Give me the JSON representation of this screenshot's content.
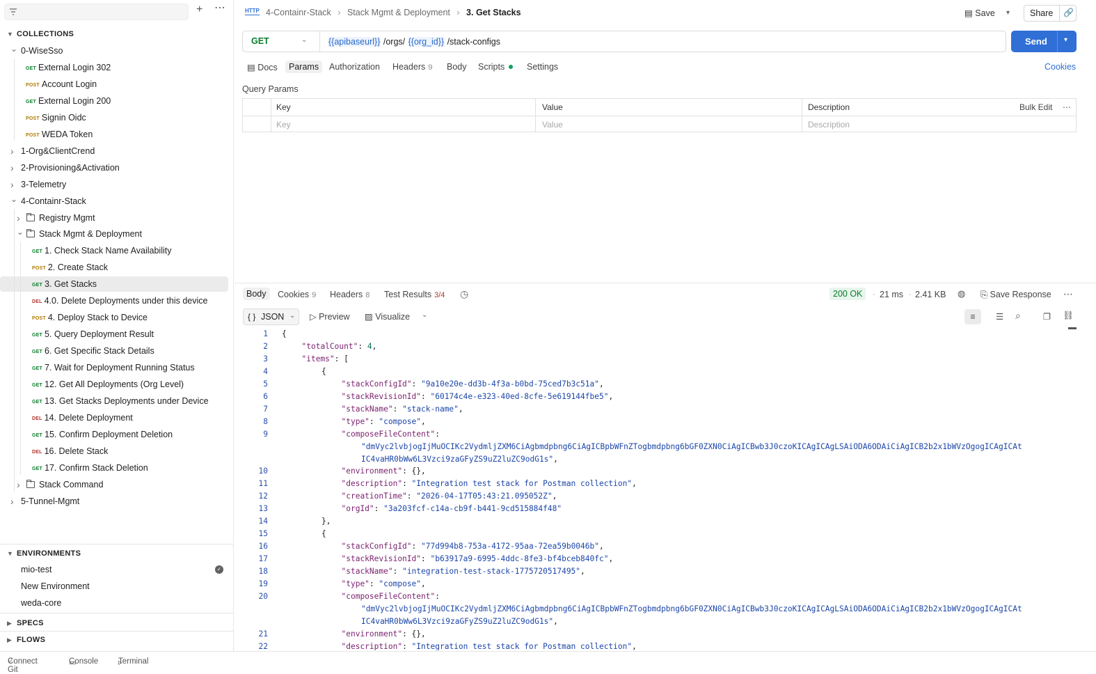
{
  "sidebar": {
    "filter_placeholder": "",
    "collections_label": "COLLECTIONS",
    "tree": [
      {
        "label": "0-WiseSso",
        "type": "collection",
        "expanded": true
      },
      {
        "method": "GET",
        "label": "External Login 302"
      },
      {
        "method": "POST",
        "label": "Account Login"
      },
      {
        "method": "GET",
        "label": "External Login 200"
      },
      {
        "method": "POST",
        "label": "Signin Oidc"
      },
      {
        "method": "POST",
        "label": "WEDA Token"
      },
      {
        "label": "1-Org&ClientCrend",
        "type": "collection",
        "expanded": false
      },
      {
        "label": "2-Provisioning&Activation",
        "type": "collection",
        "expanded": false
      },
      {
        "label": "3-Telemetry",
        "type": "collection",
        "expanded": false
      },
      {
        "label": "4-Containr-Stack",
        "type": "collection",
        "expanded": true
      },
      {
        "label": "Registry Mgmt",
        "type": "folder",
        "expanded": false
      },
      {
        "label": "Stack Mgmt & Deployment",
        "type": "folder",
        "expanded": true
      },
      {
        "method": "GET",
        "label": "1. Check Stack Name Availability"
      },
      {
        "method": "POST",
        "label": "2. Create Stack"
      },
      {
        "method": "GET",
        "label": "3. Get Stacks",
        "selected": true
      },
      {
        "method": "DEL",
        "label": "4.0. Delete Deployments under this device"
      },
      {
        "method": "POST",
        "label": "4. Deploy Stack to Device"
      },
      {
        "method": "GET",
        "label": "5. Query Deployment Result"
      },
      {
        "method": "GET",
        "label": "6. Get Specific Stack Details"
      },
      {
        "method": "GET",
        "label": "7. Wait for Deployment Running Status"
      },
      {
        "method": "GET",
        "label": "12. Get All Deployments (Org Level)"
      },
      {
        "method": "GET",
        "label": "13. Get Stacks Deployments under Device"
      },
      {
        "method": "DEL",
        "label": "14. Delete Deployment"
      },
      {
        "method": "GET",
        "label": "15. Confirm Deployment Deletion"
      },
      {
        "method": "DEL",
        "label": "16. Delete Stack"
      },
      {
        "method": "GET",
        "label": "17. Confirm Stack Deletion"
      },
      {
        "label": "Stack Command",
        "type": "folder",
        "expanded": false
      },
      {
        "label": "5-Tunnel-Mgmt",
        "type": "collection",
        "expanded": false
      }
    ],
    "environments_label": "ENVIRONMENTS",
    "environments": [
      "mio-test",
      "New Environment",
      "weda-core"
    ],
    "specs_label": "SPECS",
    "flows_label": "FLOWS"
  },
  "footer": {
    "git": "Connect Git",
    "console": "Console",
    "terminal": "Terminal"
  },
  "header": {
    "crumb1": "4-Containr-Stack",
    "crumb2": "Stack Mgmt & Deployment",
    "crumb3": "3. Get Stacks",
    "save": "Save",
    "share": "Share"
  },
  "request": {
    "method": "GET",
    "url_var1": "{{apibaseurl}}",
    "url_mid": "/orgs/",
    "url_var2": "{{org_id}}",
    "url_tail": "/stack-configs",
    "send": "Send",
    "tabs": {
      "docs": "Docs",
      "params": "Params",
      "auth": "Authorization",
      "headers": "Headers",
      "headers_count": "9",
      "body": "Body",
      "scripts": "Scripts",
      "settings": "Settings",
      "cookies": "Cookies"
    },
    "query_params_title": "Query Params",
    "table": {
      "key": "Key",
      "value": "Value",
      "description": "Description",
      "bulk_edit": "Bulk Edit",
      "key_ph": "Key",
      "value_ph": "Value",
      "desc_ph": "Description"
    }
  },
  "response": {
    "tabs": {
      "body": "Body",
      "cookies": "Cookies",
      "cookies_count": "9",
      "headers": "Headers",
      "headers_count": "8",
      "tests": "Test Results",
      "tests_count": "3/4"
    },
    "status": "200 OK",
    "time": "21 ms",
    "size": "2.41 KB",
    "save_response": "Save Response",
    "format": "JSON",
    "preview": "Preview",
    "visualize": "Visualize",
    "lines": [
      {
        "n": "1",
        "i": 0,
        "t": "{"
      },
      {
        "n": "2",
        "i": 1,
        "k": "totalCount",
        "v": "4",
        "vt": "n",
        "e": ","
      },
      {
        "n": "3",
        "i": 1,
        "k": "items",
        "v": "[",
        "vt": "p"
      },
      {
        "n": "4",
        "i": 2,
        "t": "{"
      },
      {
        "n": "5",
        "i": 3,
        "k": "stackConfigId",
        "v": "\"9a10e20e-dd3b-4f3a-b0bd-75ced7b3c51a\"",
        "vt": "s",
        "e": ","
      },
      {
        "n": "6",
        "i": 3,
        "k": "stackRevisionId",
        "v": "\"60174c4e-e323-40ed-8cfe-5e619144fbe5\"",
        "vt": "s",
        "e": ","
      },
      {
        "n": "7",
        "i": 3,
        "k": "stackName",
        "v": "\"stack-name\"",
        "vt": "s",
        "e": ","
      },
      {
        "n": "8",
        "i": 3,
        "k": "type",
        "v": "\"compose\"",
        "vt": "s",
        "e": ","
      },
      {
        "n": "9",
        "i": 3,
        "k": "composeFileContent",
        "v": "",
        "vt": "p"
      },
      {
        "n": "",
        "i": 4,
        "v": "\"dmVyc2lvbjogIjMuOCIKc2VydmljZXM6CiAgbmdpbng6CiAgICBpbWFnZTogbmdpbng6bGF0ZXN0CiAgICBwb3J0czoKICAgICAgLSAiODA6ODAiCiAgICB2b2x1bWVzOgogICAgICAt",
        "vt": "s"
      },
      {
        "n": "",
        "i": 4,
        "v": "IC4vaHR0bWw6L3Vzci9zaGFyZS9uZ2luZC9odG1s\"",
        "vt": "s",
        "e": ","
      },
      {
        "n": "10",
        "i": 3,
        "k": "environment",
        "v": "{}",
        "vt": "p",
        "e": ","
      },
      {
        "n": "11",
        "i": 3,
        "k": "description",
        "v": "\"Integration test stack for Postman collection\"",
        "vt": "s",
        "e": ","
      },
      {
        "n": "12",
        "i": 3,
        "k": "creationTime",
        "v": "\"2026-04-17T05:43:21.095052Z\"",
        "vt": "s",
        "e": ","
      },
      {
        "n": "13",
        "i": 3,
        "k": "orgId",
        "v": "\"3a203fcf-c14a-cb9f-b441-9cd515884f48\"",
        "vt": "s"
      },
      {
        "n": "14",
        "i": 2,
        "t": "},"
      },
      {
        "n": "15",
        "i": 2,
        "t": "{"
      },
      {
        "n": "16",
        "i": 3,
        "k": "stackConfigId",
        "v": "\"77d994b8-753a-4172-95aa-72ea59b0046b\"",
        "vt": "s",
        "e": ","
      },
      {
        "n": "17",
        "i": 3,
        "k": "stackRevisionId",
        "v": "\"b63917a9-6995-4ddc-8fe3-bf4bceb840fc\"",
        "vt": "s",
        "e": ","
      },
      {
        "n": "18",
        "i": 3,
        "k": "stackName",
        "v": "\"integration-test-stack-1775720517495\"",
        "vt": "s",
        "e": ","
      },
      {
        "n": "19",
        "i": 3,
        "k": "type",
        "v": "\"compose\"",
        "vt": "s",
        "e": ","
      },
      {
        "n": "20",
        "i": 3,
        "k": "composeFileContent",
        "v": "",
        "vt": "p"
      },
      {
        "n": "",
        "i": 4,
        "v": "\"dmVyc2lvbjogIjMuOCIKc2VydmljZXM6CiAgbmdpbng6CiAgICBpbWFnZTogbmdpbng6bGF0ZXN0CiAgICBwb3J0czoKICAgICAgLSAiODA6ODAiCiAgICB2b2x1bWVzOgogICAgICAt",
        "vt": "s"
      },
      {
        "n": "",
        "i": 4,
        "v": "IC4vaHR0bWw6L3Vzci9zaGFyZS9uZ2luZC9odG1s\"",
        "vt": "s",
        "e": ","
      },
      {
        "n": "21",
        "i": 3,
        "k": "environment",
        "v": "{}",
        "vt": "p",
        "e": ","
      },
      {
        "n": "22",
        "i": 3,
        "k": "description",
        "v": "\"Integration test stack for Postman collection\"",
        "vt": "s",
        "e": ","
      }
    ]
  },
  "colors": {
    "accent": "#2f6fd6",
    "get": "#0a7d2c",
    "post": "#ad7a03",
    "del": "#b0352c",
    "ok": "#0a7d2c"
  }
}
